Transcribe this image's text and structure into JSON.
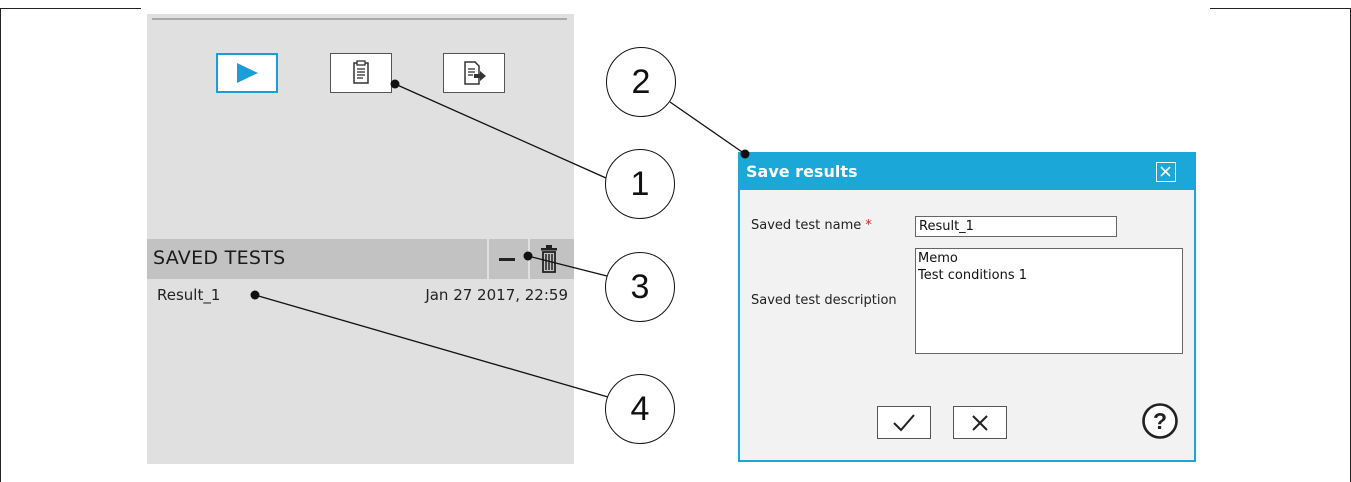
{
  "side_panel": {
    "toolbar": {
      "run_icon": "play-icon",
      "report_icon": "clipboard-document-icon",
      "export_icon": "document-export-icon",
      "accent_color": "#1a9ed8"
    },
    "saved_tests": {
      "title": "SAVED TESTS",
      "remove_icon": "minus-icon",
      "delete_icon": "trash-icon",
      "rows": [
        {
          "name": "Result_1",
          "date": "Jan 27 2017, 22:59"
        }
      ]
    }
  },
  "dialog": {
    "title": "Save results",
    "close_icon": "close-icon",
    "name_label": "Saved test name",
    "required_marker": "*",
    "name_value": "Result_1",
    "description_label": "Saved test description",
    "description_lines": [
      "Memo",
      "Test conditions 1"
    ],
    "ok_icon": "checkmark-icon",
    "cancel_icon": "x-icon",
    "help_icon": "help-icon",
    "accent_color": "#1ba8d8"
  },
  "callouts": [
    "2",
    "1",
    "3",
    "4"
  ]
}
